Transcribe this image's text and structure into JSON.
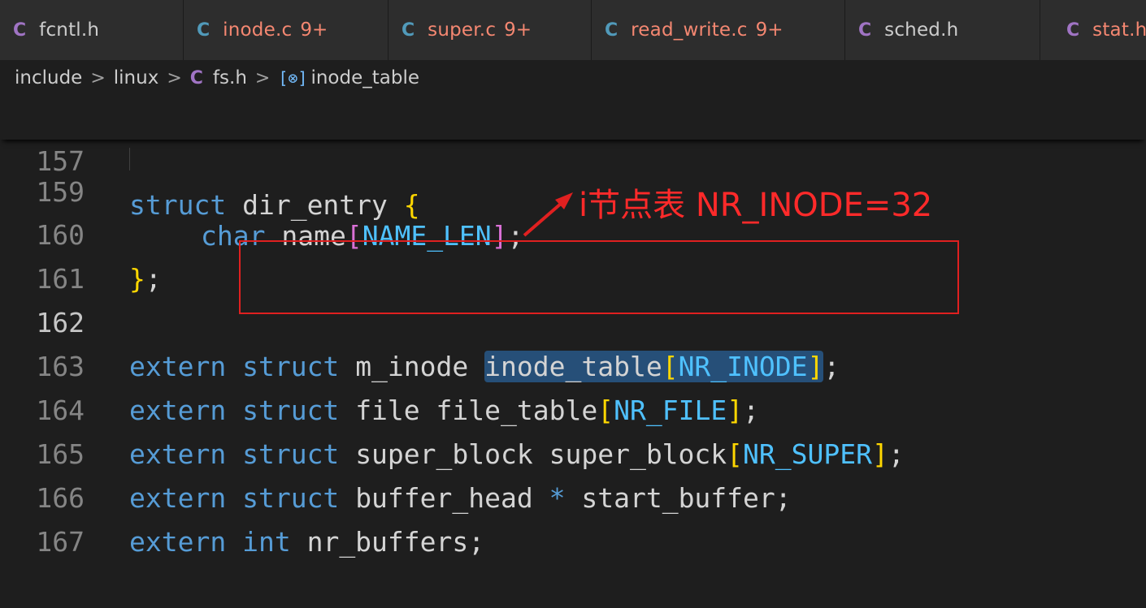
{
  "tabs": [
    {
      "icon": "C",
      "name": "fcntl.h",
      "badge": "",
      "color": "#cccccc",
      "icon_color": "#a074c4"
    },
    {
      "icon": "C",
      "name": "inode.c",
      "badge": "9+",
      "color": "#f48771",
      "icon_color": "#519aba"
    },
    {
      "icon": "C",
      "name": "super.c",
      "badge": "9+",
      "color": "#f48771",
      "icon_color": "#519aba"
    },
    {
      "icon": "C",
      "name": "read_write.c",
      "badge": "9+",
      "color": "#f48771",
      "icon_color": "#519aba"
    },
    {
      "icon": "C",
      "name": "sched.h",
      "badge": "",
      "color": "#cccccc",
      "icon_color": "#a074c4"
    },
    {
      "icon": "C",
      "name": "stat.h",
      "badge": "",
      "color": "#f48771",
      "icon_color": "#a074c4"
    }
  ],
  "breadcrumb": {
    "parts": [
      "include",
      "linux"
    ],
    "file_icon": "C",
    "file": "fs.h",
    "symbol_icon": "[⊗]",
    "symbol": "inode_table",
    "sep": ">"
  },
  "sticky": {
    "ln": "157",
    "kw": "struct",
    "name": "dir_entry",
    "brace": "{"
  },
  "lines": {
    "l159": {
      "ln": "159",
      "kw": "char",
      "name": "name",
      "lb": "[",
      "const": "NAME_LEN",
      "rb": "]",
      "end": ";"
    },
    "l160": {
      "ln": "160",
      "brace": "}",
      "end": ";"
    },
    "l161": {
      "ln": "161"
    },
    "l162": {
      "ln": "162",
      "kw1": "extern",
      "kw2": "struct",
      "type": "m_inode",
      "ident": "inode_table",
      "lb": "[",
      "const": "NR_INODE",
      "rb": "]",
      "end": ";"
    },
    "l163": {
      "ln": "163",
      "kw1": "extern",
      "kw2": "struct",
      "type": "file",
      "ident": "file_table",
      "lb": "[",
      "const": "NR_FILE",
      "rb": "]",
      "end": ";"
    },
    "l164": {
      "ln": "164",
      "kw1": "extern",
      "kw2": "struct",
      "type": "super_block",
      "ident": "super_block",
      "lb": "[",
      "const": "NR_SUPER",
      "rb": "]",
      "end": ";"
    },
    "l165": {
      "ln": "165",
      "kw1": "extern",
      "kw2": "struct",
      "type": "buffer_head",
      "star": "*",
      "ident": "start_buffer",
      "end": ";"
    },
    "l166": {
      "ln": "166",
      "kw1": "extern",
      "kw2": "int",
      "ident": "nr_buffers",
      "end": ";"
    },
    "l167": {
      "ln": "167"
    }
  },
  "annotation": {
    "text": "i节点表 NR_INODE=32",
    "color": "#ff2a2a"
  }
}
